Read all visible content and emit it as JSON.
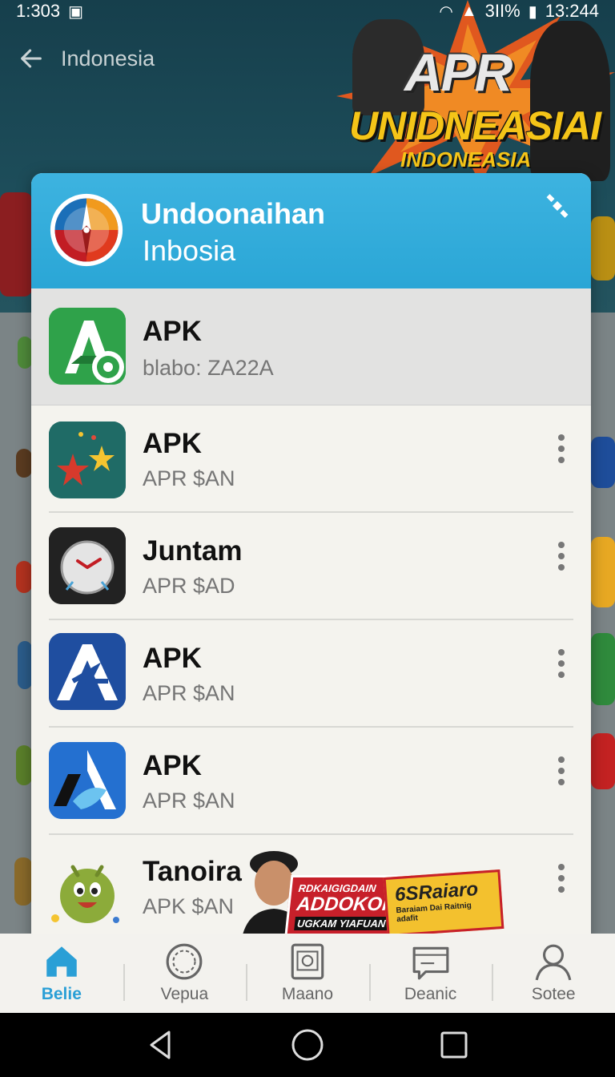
{
  "status_bar": {
    "time_left": "1:303",
    "battery": "3II%",
    "time_right": "13:244"
  },
  "background": {
    "title": "Indonesia",
    "promo": {
      "line1": "APR",
      "line2": "UNIDNEASIAI",
      "line3": "INDONEASIA"
    }
  },
  "dialog": {
    "title": "Undoonaihan",
    "subtitle": "Inbosia",
    "selected": {
      "name": "APK",
      "sub": "blabo: ZA22A"
    },
    "items": [
      {
        "name": "APK",
        "sub": "APR $AN"
      },
      {
        "name": "Juntam",
        "sub": "APR $AD"
      },
      {
        "name": "APK",
        "sub": "APR $AN"
      },
      {
        "name": "APK",
        "sub": "APR $AN"
      },
      {
        "name": "Tanoira",
        "sub": "APK $AN"
      }
    ]
  },
  "ad": {
    "red_line1": "RDKAIGIGDAIN",
    "red_line2": "ADDOKOHI",
    "red_line3": "UGKAM YIAFUAN",
    "yellow_line1": "6SRaiaro",
    "yellow_line2": "Baraiam Dai Raitnig adafit"
  },
  "bottom_nav": [
    {
      "label": "Belie",
      "icon": "home-icon",
      "active": true
    },
    {
      "label": "Vepua",
      "icon": "explore-icon",
      "active": false
    },
    {
      "label": "Maano",
      "icon": "media-icon",
      "active": false
    },
    {
      "label": "Deanic",
      "icon": "chat-icon",
      "active": false
    },
    {
      "label": "Sotee",
      "icon": "person-icon",
      "active": false
    }
  ],
  "colors": {
    "accent": "#2aa6d6",
    "header_bg": "#1d4d5a",
    "dialog_bg": "#f4f3ee"
  }
}
